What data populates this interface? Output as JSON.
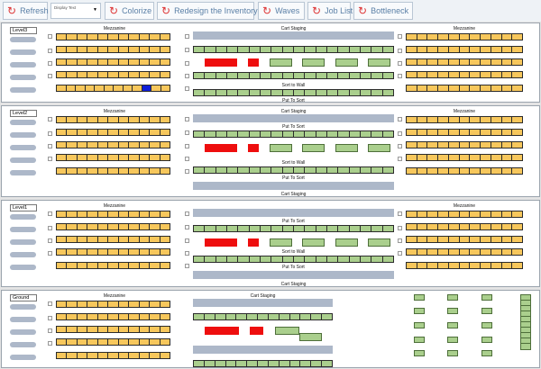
{
  "toolbar": {
    "refresh": "Refresh",
    "display_select": "Display Text",
    "colorize": "Colorize",
    "redesign": "Redesign the Inventory",
    "waves": "Waves",
    "job_list": "Job List",
    "bottleneck": "Bottleneck"
  },
  "colors": {
    "mezzanine_slot": "#f7c75c",
    "highlight_slot": "#0f1fd8",
    "sort_slot": "#aacf8d",
    "bottleneck": "#ee0e0e",
    "staging": "#adb8c9"
  },
  "levels": [
    {
      "name": "Level3",
      "mezz_left": "Mezzanine",
      "mezz_right": "Mezzanine",
      "cart_staging": "Cart Staging",
      "sort_to_wall": "Sort to Wall",
      "put_to_sort": "Put To Sort"
    },
    {
      "name": "Level2",
      "mezz_left": "Mezzanine",
      "mezz_right": "Mezzanine",
      "cart_staging": "Cart Staging",
      "put_to_sort_top": "Put To Sort",
      "sort_to_wall": "Sort to Wall",
      "put_to_sort": "Put To Sort",
      "cart_staging_bottom": "Cart Staging"
    },
    {
      "name": "Level1",
      "mezz_left": "Mezzanine",
      "mezz_right": "Mezzanine",
      "put_to_sort_top": "Put To Sort",
      "sort_to_wall": "Sort to Wall",
      "put_to_sort": "Put To Sort",
      "cart_staging_bottom": "Cart Staging"
    },
    {
      "name": "Ground",
      "mezz_left": "Mezzanine",
      "cart_staging": "Cart Staging"
    }
  ]
}
